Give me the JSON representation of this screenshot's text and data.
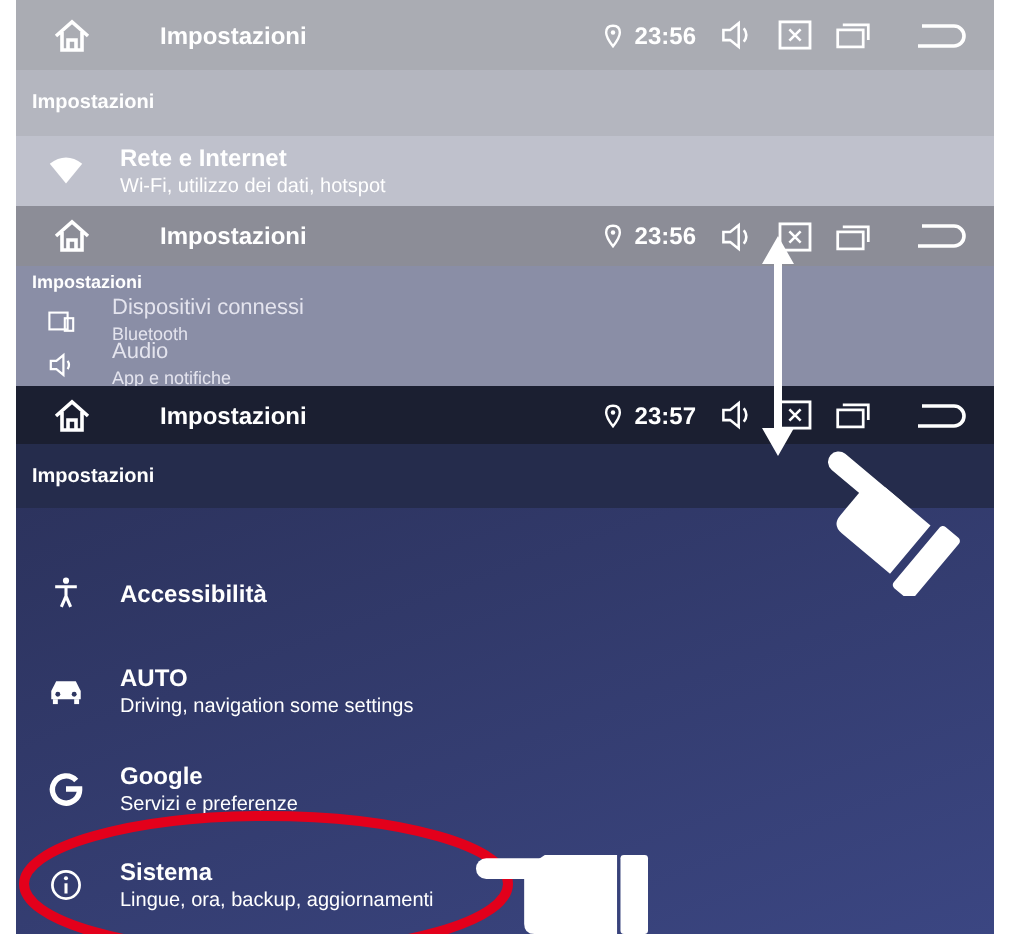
{
  "panels": [
    {
      "status_bar": {
        "title": "Impostazioni",
        "time": "23:56"
      },
      "section_header": "Impostazioni",
      "items": [
        {
          "kind": "wifi",
          "title": "Rete e Internet",
          "subtitle": "Wi-Fi, utilizzo dei dati, hotspot"
        }
      ]
    },
    {
      "status_bar": {
        "title": "Impostazioni",
        "time": "23:56"
      },
      "section_header": "Impostazioni",
      "items": [
        {
          "kind": "devices",
          "title": "Dispositivi connessi",
          "subtitle": "Bluetooth"
        },
        {
          "kind": "audio",
          "title": "Audio",
          "subtitle": "App e notifiche"
        }
      ]
    },
    {
      "status_bar": {
        "title": "Impostazioni",
        "time": "23:57"
      },
      "section_header": "Impostazioni",
      "items": [
        {
          "kind": "accessibility",
          "title": "Accessibilità"
        },
        {
          "kind": "car",
          "title": "AUTO",
          "subtitle": "Driving, navigation some settings"
        },
        {
          "kind": "google",
          "title": "Google",
          "subtitle": "Servizi e preferenze"
        },
        {
          "kind": "info",
          "title": "Sistema",
          "subtitle": "Lingue, ora, backup, aggiornamenti"
        }
      ]
    }
  ]
}
